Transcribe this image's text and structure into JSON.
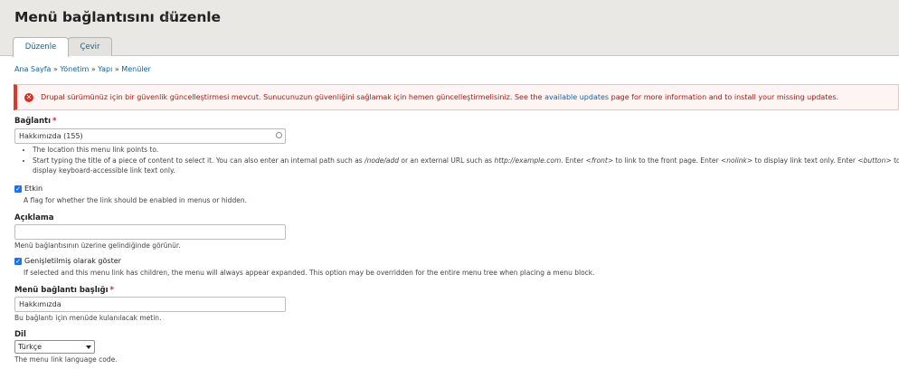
{
  "page": {
    "title": "Menü bağlantısını düzenle",
    "star_icon": "☆"
  },
  "tabs": [
    {
      "label": "Düzenle",
      "active": true
    },
    {
      "label": "Çevir",
      "active": false
    }
  ],
  "breadcrumb": {
    "items": [
      "Ana Sayfa",
      "Yönetim",
      "Yapı",
      "Menüler"
    ],
    "separator": "»"
  },
  "alert": {
    "icon": "error-icon",
    "text_before": "Drupal sürümünüz için bir güvenlik güncelleştirmesi mevcut. Sunucunuzun güvenliğini sağlamak için hemen güncelleştirmelisiniz. See the",
    "link_text": "available updates",
    "text_after": "page for more information and to install your missing updates."
  },
  "form": {
    "link": {
      "label": "Bağlantı",
      "required_mark": "*",
      "value": "Hakkımızda (155)",
      "help": [
        {
          "text": "The location this menu link points to."
        },
        {
          "parts": [
            "Start typing the title of a piece of content to select it. You can also enter an internal path such as ",
            "/node/add",
            " or an external URL such as ",
            "http://example.com",
            ". Enter ",
            "<front>",
            " to link to the front page. Enter ",
            "<nolink>",
            " to display link text only. Enter ",
            "<button>",
            " to display keyboard-accessible link text only."
          ]
        }
      ]
    },
    "enabled": {
      "label": "Etkin",
      "checked": true,
      "description": "A flag for whether the link should be enabled in menus or hidden."
    },
    "description_field": {
      "label": "Açıklama",
      "value": "",
      "description": "Menü bağlantısının üzerine gelindiğinde görünür."
    },
    "expanded": {
      "label": "Genişletilmiş olarak göster",
      "checked": true,
      "description": "If selected and this menu link has children, the menu will always appear expanded. This option may be overridden for the entire menu tree when placing a menu block."
    },
    "title_field": {
      "label": "Menü bağlantı başlığı",
      "required_mark": "*",
      "value": "Hakkımızda",
      "description": "Bu bağlantı için menüde kulanılacak metin."
    },
    "language": {
      "label": "Dil",
      "selected": "Türkçe",
      "description": "The menu link language code."
    }
  },
  "colors": {
    "link": "#0b64a8",
    "error": "#d72f22",
    "header_bg": "#e9e8e4"
  }
}
